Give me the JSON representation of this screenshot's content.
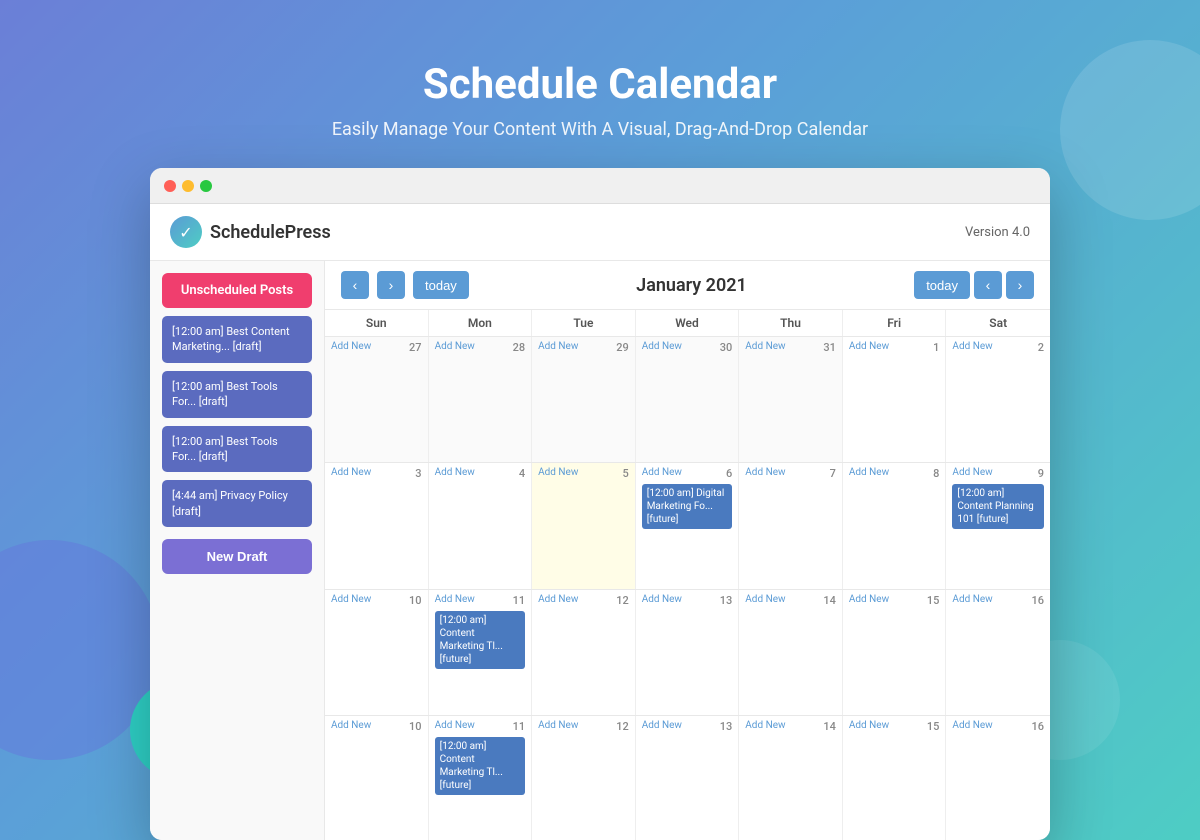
{
  "hero": {
    "title": "Schedule Calendar",
    "subtitle": "Easily Manage Your Content With A Visual, Drag-And-Drop Calendar"
  },
  "browser": {
    "dots": [
      "red",
      "yellow",
      "green"
    ]
  },
  "app": {
    "name": "SchedulePress",
    "version": "Version 4.0",
    "logo_char": "✓"
  },
  "sidebar": {
    "unscheduled_label": "Unscheduled Posts",
    "posts": [
      "[12:00 am] Best Content Marketing... [draft]",
      "[12:00 am] Best Tools For... [draft]",
      "[12:00 am] Best Tools For... [draft]",
      "[4:44 am] Privacy Policy [draft]"
    ],
    "new_draft_label": "New Draft"
  },
  "calendar": {
    "month_title": "January 2021",
    "today_label_left": "today",
    "today_label_right": "today",
    "days": [
      "Sun",
      "Mon",
      "Tue",
      "Wed",
      "Thu",
      "Fri",
      "Sat"
    ],
    "weeks": [
      {
        "cells": [
          {
            "date": 27,
            "other": true,
            "addNew": true,
            "events": []
          },
          {
            "date": 28,
            "other": true,
            "addNew": true,
            "events": []
          },
          {
            "date": 29,
            "other": true,
            "addNew": true,
            "events": []
          },
          {
            "date": 30,
            "other": true,
            "addNew": true,
            "events": []
          },
          {
            "date": 31,
            "other": true,
            "addNew": true,
            "events": []
          },
          {
            "date": 1,
            "other": false,
            "addNew": true,
            "events": []
          },
          {
            "date": 2,
            "other": false,
            "addNew": true,
            "events": []
          }
        ]
      },
      {
        "cells": [
          {
            "date": 3,
            "other": false,
            "addNew": true,
            "events": []
          },
          {
            "date": 4,
            "other": false,
            "addNew": true,
            "events": []
          },
          {
            "date": 5,
            "other": false,
            "today": true,
            "addNew": true,
            "events": []
          },
          {
            "date": 6,
            "other": false,
            "addNew": true,
            "events": [
              "[12:00 am] Digital Marketing Fo... [future]"
            ]
          },
          {
            "date": 7,
            "other": false,
            "addNew": true,
            "events": []
          },
          {
            "date": 8,
            "other": false,
            "addNew": true,
            "events": []
          },
          {
            "date": 9,
            "other": false,
            "addNew": true,
            "events": [
              "[12:00 am] Content Planning 101 [future]"
            ]
          }
        ]
      },
      {
        "cells": [
          {
            "date": 10,
            "other": false,
            "addNew": true,
            "events": []
          },
          {
            "date": 11,
            "other": false,
            "addNew": true,
            "events": [
              "[12:00 am] Content Marketing Tl... [future]"
            ]
          },
          {
            "date": 12,
            "other": false,
            "addNew": true,
            "events": []
          },
          {
            "date": 13,
            "other": false,
            "addNew": true,
            "events": []
          },
          {
            "date": 14,
            "other": false,
            "addNew": true,
            "events": []
          },
          {
            "date": 15,
            "other": false,
            "addNew": true,
            "events": []
          },
          {
            "date": 16,
            "other": false,
            "addNew": true,
            "events": []
          }
        ]
      },
      {
        "cells": [
          {
            "date": 10,
            "other": false,
            "addNew": true,
            "events": []
          },
          {
            "date": 11,
            "other": false,
            "addNew": true,
            "events": [
              "[12:00 am] Content Marketing Tl... [future]"
            ]
          },
          {
            "date": 12,
            "other": false,
            "addNew": true,
            "events": []
          },
          {
            "date": 13,
            "other": false,
            "addNew": true,
            "events": []
          },
          {
            "date": 14,
            "other": false,
            "addNew": true,
            "events": []
          },
          {
            "date": 15,
            "other": false,
            "addNew": true,
            "events": []
          },
          {
            "date": 16,
            "other": false,
            "addNew": true,
            "events": []
          }
        ]
      }
    ]
  }
}
